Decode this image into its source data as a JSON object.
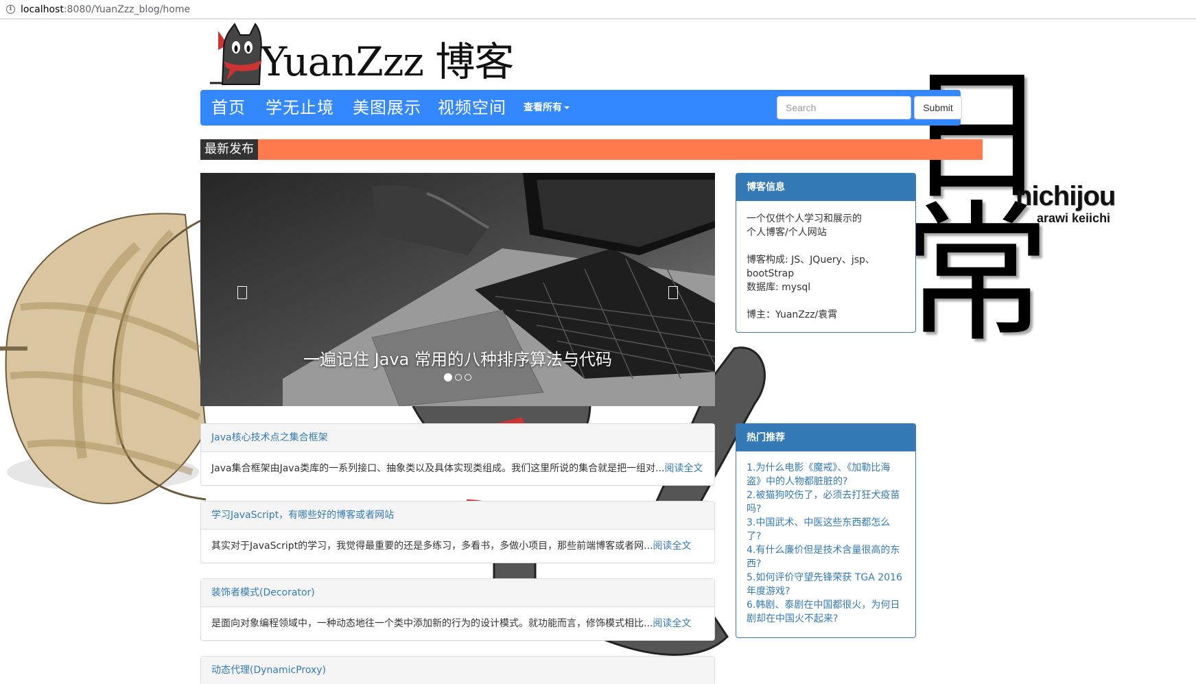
{
  "browser": {
    "url_host": "localhost",
    "url_path": ":8080/YuanZzz_blog/home"
  },
  "background": {
    "ri": "日",
    "chang": "常",
    "nichijou": "nichijou",
    "author": "arawi keiichi"
  },
  "logo": {
    "text": "YuanZzz 博客"
  },
  "nav": {
    "items": [
      "首页",
      "学无止境",
      "美图展示",
      "视频空间"
    ],
    "dropdown_label": "查看所有",
    "search_placeholder": "Search",
    "submit_label": "Submit"
  },
  "latest": {
    "label": "最新发布"
  },
  "carousel": {
    "caption": "一遍记住 Java 常用的八种排序算法与代码",
    "slide_count": 3,
    "active_index": 0
  },
  "articles": [
    {
      "title": "Java核心技术点之集合框架",
      "summary": "Java集合框架由Java类库的一系列接口、抽象类以及具体实现类组成。我们这里所说的集合就是把一组对...",
      "more": "阅读全文"
    },
    {
      "title": "学习JavaScript，有哪些好的博客或者网站",
      "summary": "其实对于JavaScript的学习，我觉得最重要的还是多练习，多看书，多做小项目，那些前端博客或者网...",
      "more": "阅读全文"
    },
    {
      "title": "装饰者模式(Decorator)",
      "summary": "是面向对象编程领域中，一种动态地往一个类中添加新的行为的设计模式。就功能而言，修饰模式相比...",
      "more": "阅读全文"
    },
    {
      "title": "动态代理(DynamicProxy)",
      "summary": "",
      "more": ""
    }
  ],
  "blog_info": {
    "title": "博客信息",
    "line1": "一个仅供个人学习和展示的",
    "line2": "个人博客/个人网站",
    "line3": "博客构成: JS、JQuery、jsp、",
    "line4": "bootStrap",
    "line5": "数据库: mysql",
    "line6": "博主：YuanZzz/袁霄"
  },
  "hot": {
    "title": "热门推荐",
    "items": [
      "1.为什么电影《魔戒》、《加勒比海",
      "盗》中的人物都脏脏的?",
      "2.被猫狗咬伤了，必须去打狂犬疫苗",
      "吗?",
      "3.中国武术、中医这些东西都怎么",
      "了?",
      "4.有什么廉价但是技术含量很高的东",
      "西?",
      "5.如何评价守望先锋荣获 TGA 2016",
      "年度游戏?",
      "6.韩剧、泰剧在中国都很火，为何日",
      "剧却在中国火不起来?"
    ]
  },
  "colors": {
    "navbar": "#3388ff",
    "latest_bar": "#ff7a4d",
    "panel_primary": "#337ab7",
    "link": "#337ab7"
  }
}
